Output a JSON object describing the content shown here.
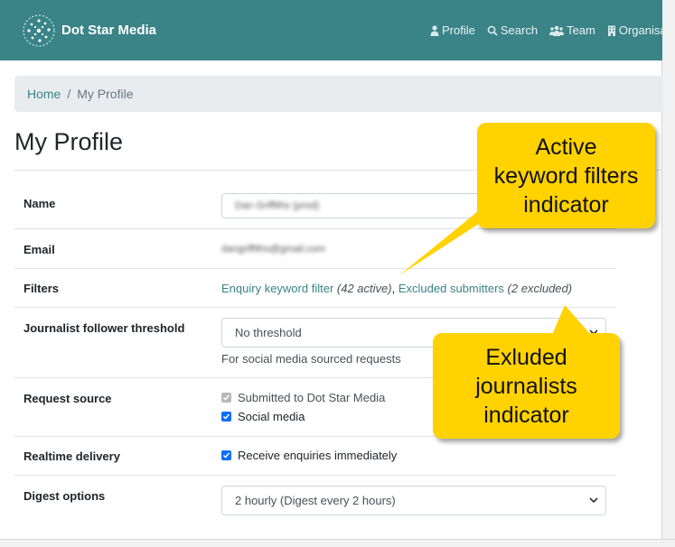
{
  "brand": {
    "name": "Dot Star Media"
  },
  "nav": [
    {
      "label": "Profile",
      "icon": "user-icon"
    },
    {
      "label": "Search",
      "icon": "search-icon"
    },
    {
      "label": "Team",
      "icon": "team-icon"
    },
    {
      "label": "Organisa",
      "icon": "building-icon"
    }
  ],
  "breadcrumb": {
    "home": "Home",
    "separator": "/",
    "current": "My Profile"
  },
  "page_title": "My Profile",
  "rows": {
    "name": {
      "label": "Name",
      "value": "Dan Griffiths (prod)"
    },
    "email": {
      "label": "Email",
      "value": "dangriffiths@gmail.com"
    },
    "filters": {
      "label": "Filters",
      "keyword_link": "Enquiry keyword filter",
      "keyword_count": "(42 active)",
      "comma": ",",
      "submitters_link": "Excluded submitters",
      "submitters_count": "(2 excluded)"
    },
    "threshold": {
      "label": "Journalist follower threshold",
      "selected": "No threshold",
      "help": "For social media sourced requests"
    },
    "source": {
      "label": "Request source",
      "option1": "Submitted to Dot Star Media",
      "option2": "Social media"
    },
    "realtime": {
      "label": "Realtime delivery",
      "option": "Receive enquiries immediately"
    },
    "digest": {
      "label": "Digest options",
      "selected": "2 hourly (Digest every 2 hours)"
    }
  },
  "callouts": {
    "active": {
      "line1": "Active",
      "line2": "keyword filters",
      "line3": "indicator"
    },
    "excluded": {
      "line1": "Exluded",
      "line2": "journalists",
      "line3": "indicator"
    }
  },
  "colors": {
    "navbar": "#3a8387",
    "link": "#3a8387",
    "callout": "#ffd200",
    "checkbox": "#0d6efd"
  }
}
